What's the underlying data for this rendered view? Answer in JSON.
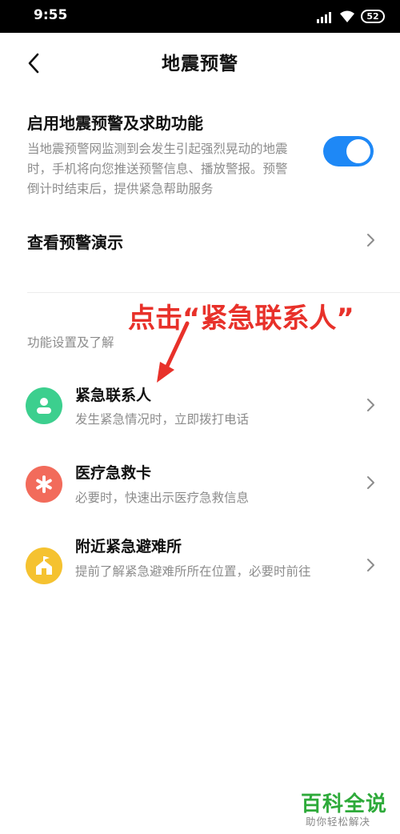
{
  "status_bar": {
    "time": "9:55",
    "battery": "52",
    "icons": [
      "signal-icon",
      "wifi-icon",
      "battery-icon"
    ]
  },
  "header": {
    "title": "地震预警",
    "back_icon": "chevron-left-icon"
  },
  "main_toggle": {
    "title": "启用地震预警及求助功能",
    "description": "当地震预警网监测到会发生引起强烈晃动的地震时，手机将向您推送预警信息、播放警报。预警倒计时结束后，提供紧急帮助服务",
    "enabled": true,
    "color": "#1e88f6"
  },
  "demo_row": {
    "label": "查看预警演示"
  },
  "annotation": {
    "text": "点击“紧急联系人”",
    "color": "#e8312a"
  },
  "section": {
    "label": "功能设置及了解"
  },
  "items": [
    {
      "title": "紧急联系人",
      "subtitle": "发生紧急情况时，立即拨打电话",
      "icon": "person-icon",
      "color": "#3ccf8e"
    },
    {
      "title": "医疗急救卡",
      "subtitle": "必要时，快速出示医疗急救信息",
      "icon": "asterisk-icon",
      "color": "#f26b5b"
    },
    {
      "title": "附近紧急避难所",
      "subtitle": "提前了解紧急避难所所在位置，必要时前往",
      "icon": "shelter-icon",
      "color": "#f5c230"
    }
  ],
  "watermark": {
    "main": "百科全说",
    "sub": "助你轻松解决"
  }
}
